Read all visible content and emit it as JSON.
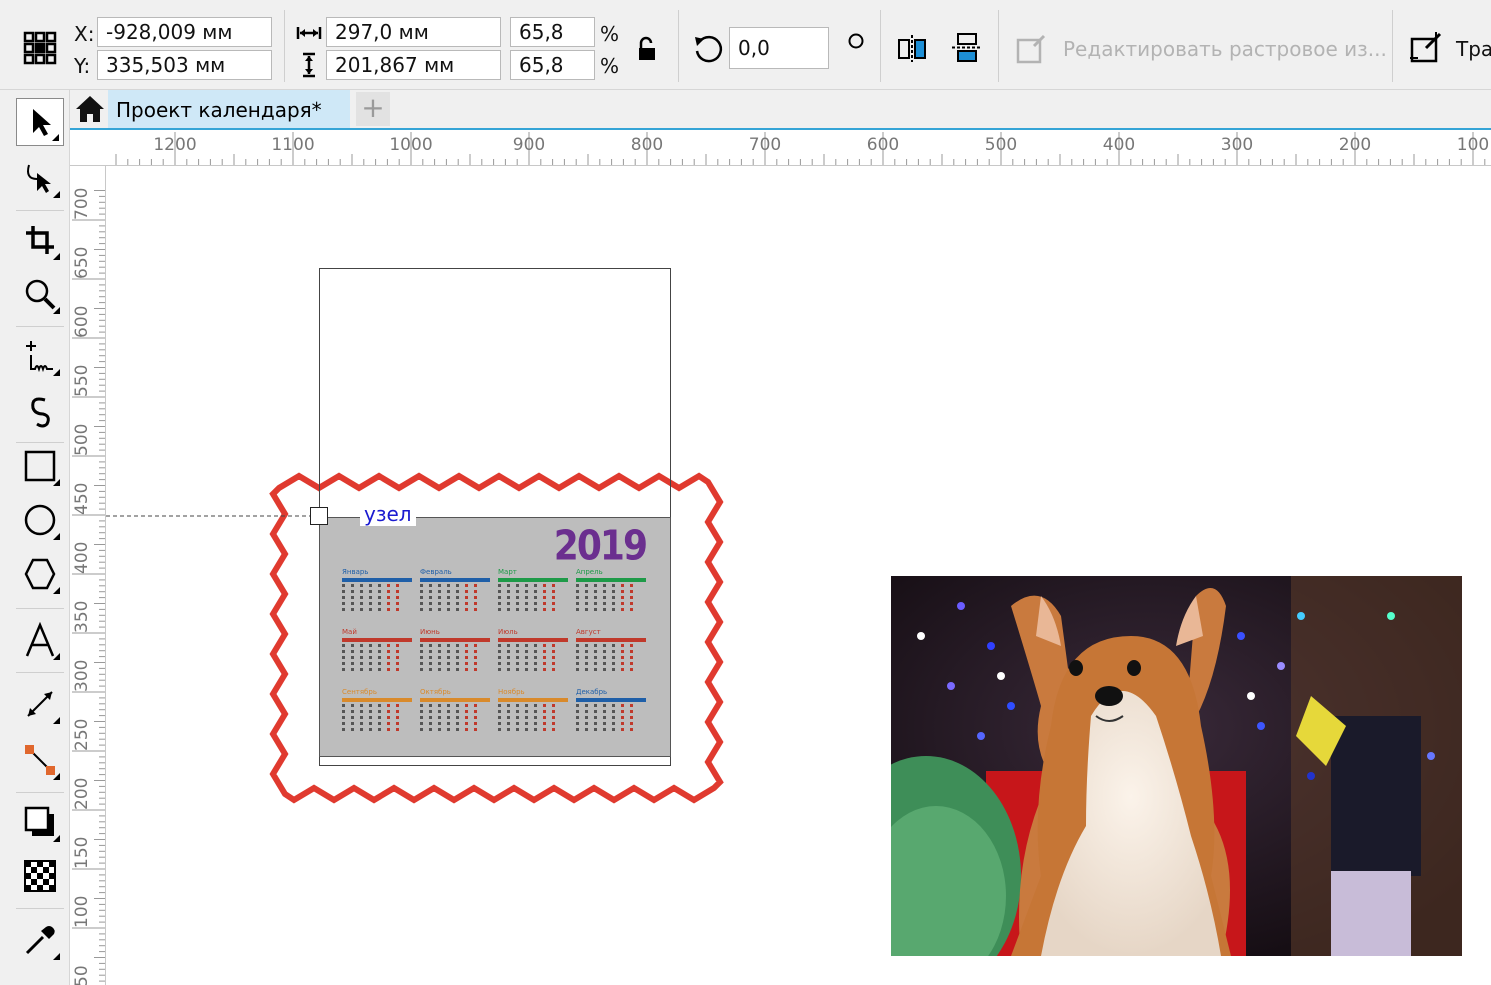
{
  "propbar": {
    "x_label": "X:",
    "y_label": "Y:",
    "x_value": "-928,009 мм",
    "y_value": "335,503 мм",
    "width_value": "297,0 мм",
    "height_value": "201,867 мм",
    "scale_w": "65,8",
    "scale_h": "65,8",
    "percent": "%",
    "rotation": "0,0",
    "edit_bitmap": "Редактировать растровое из...",
    "trace_label": "Тра"
  },
  "tabs": {
    "document": "Проект календаря*",
    "add": "+"
  },
  "ruler_h": [
    "1200",
    "1100",
    "1000",
    "900",
    "800",
    "700",
    "600",
    "500",
    "400",
    "300",
    "200",
    "100"
  ],
  "ruler_v": [
    "700",
    "650",
    "600",
    "550",
    "500",
    "450",
    "400",
    "350",
    "300",
    "250",
    "200",
    "150",
    "100",
    "50"
  ],
  "canvas": {
    "node_label": "узел",
    "calendar_year": "2019",
    "months": [
      "Январь",
      "Февраль",
      "Март",
      "Апрель",
      "Май",
      "Июнь",
      "Июль",
      "Август",
      "Сентябрь",
      "Октябрь",
      "Ноябрь",
      "Декабрь"
    ],
    "month_colors": [
      "#1f5fa8",
      "#1f5fa8",
      "#1e9a48",
      "#1e9a48",
      "#c0392b",
      "#c0392b",
      "#c0392b",
      "#c0392b",
      "#d98a2b",
      "#d98a2b",
      "#d98a2b",
      "#1f5fa8"
    ]
  },
  "colors": {
    "accent": "#35a4d6",
    "frame_red": "#e03a2f",
    "year_purple": "#6b2f8f",
    "node_blue": "#1a1ad0"
  },
  "tools": [
    "pick-tool",
    "shape-tool",
    "crop-tool",
    "zoom-tool",
    "freehand-tool",
    "artistic-media-tool",
    "rectangle-tool",
    "ellipse-tool",
    "polygon-tool",
    "text-tool",
    "parallel-dimension-tool",
    "connector-tool",
    "drop-shadow-tool",
    "transparency-tool",
    "eyedropper-tool"
  ]
}
